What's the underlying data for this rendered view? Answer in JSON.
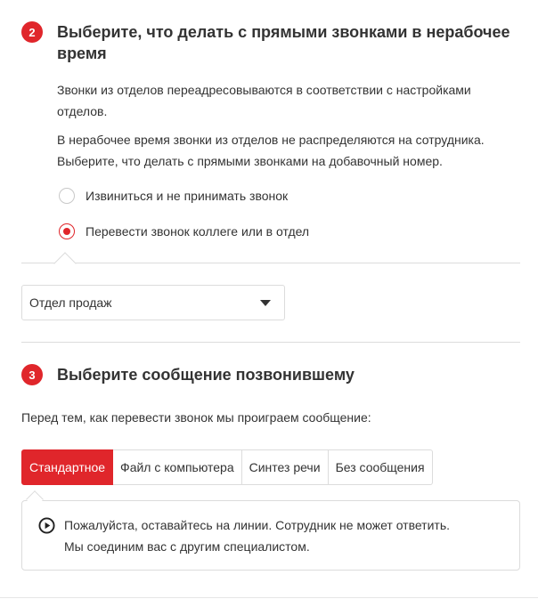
{
  "step2": {
    "badge": "2",
    "title_line1": "Выберите, что делать с прямыми звонками в нерабочее",
    "title_line2": "время",
    "info_line1": "Звонки из отделов переадресовываются в соответствии с настройками",
    "info_line2": "отделов.",
    "info_line3": "В нерабочее время звонки из отделов не распределяются на сотрудника.",
    "info_line4": "Выберите, что делать с прямыми звонками на добавочный номер.",
    "options": [
      {
        "label": "Извиниться и не принимать звонок",
        "checked": false
      },
      {
        "label": "Перевести звонок коллеге или в отдел",
        "checked": true
      }
    ],
    "department_select": {
      "value": "Отдел продаж"
    }
  },
  "step3": {
    "badge": "3",
    "title": "Выберите сообщение позвонившему",
    "intro": "Перед тем, как перевести звонок мы проиграем сообщение:",
    "tabs": [
      {
        "label": "Стандартное",
        "active": true
      },
      {
        "label": "Файл с компьютера",
        "active": false
      },
      {
        "label": "Синтез речи",
        "active": false
      },
      {
        "label": "Без сообщения",
        "active": false
      }
    ],
    "message_line1": "Пожалуйста, оставайтесь на линии. Сотрудник не может ответить.",
    "message_line2": "Мы соединим вас с другим специалистом."
  },
  "colors": {
    "accent": "#e0262b",
    "border": "#dcdcdc",
    "text": "#333333"
  },
  "icons": {
    "play": "play-circle-icon",
    "dropdown": "caret-down-icon"
  }
}
